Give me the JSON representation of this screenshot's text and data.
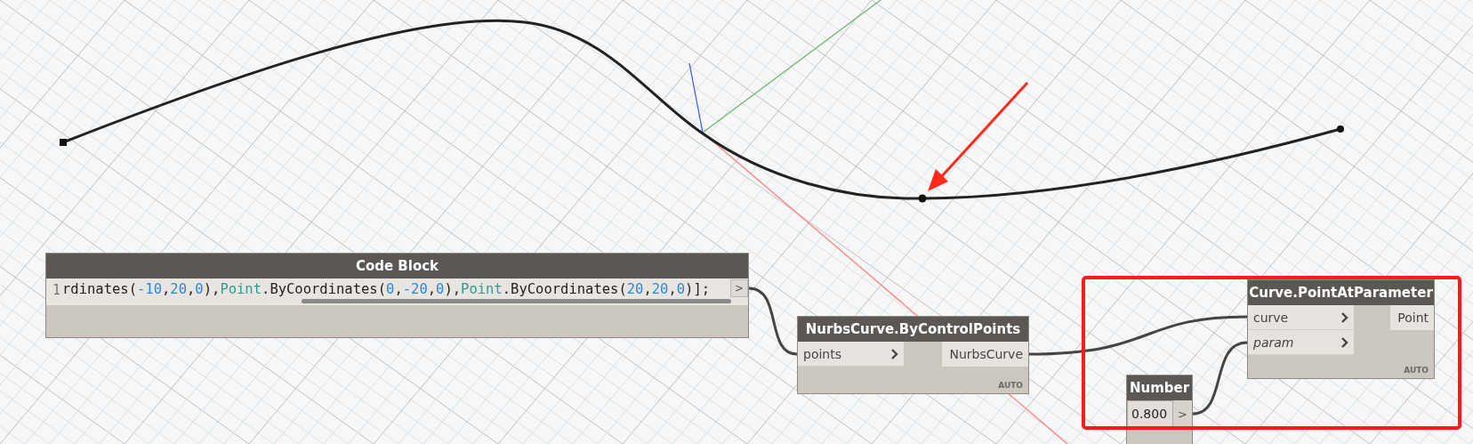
{
  "code_block": {
    "title": "Code Block",
    "line_number": "1",
    "tokens": [
      {
        "text": "rdinates(",
        "kind": "plain"
      },
      {
        "text": "-10",
        "kind": "number"
      },
      {
        "text": ",",
        "kind": "plain"
      },
      {
        "text": "20",
        "kind": "number"
      },
      {
        "text": ",",
        "kind": "plain"
      },
      {
        "text": "0",
        "kind": "number"
      },
      {
        "text": "),",
        "kind": "plain"
      },
      {
        "text": "Point",
        "kind": "type"
      },
      {
        "text": ".ByCoordinates(",
        "kind": "plain"
      },
      {
        "text": "0",
        "kind": "number"
      },
      {
        "text": ",",
        "kind": "plain"
      },
      {
        "text": "-20",
        "kind": "number"
      },
      {
        "text": ",",
        "kind": "plain"
      },
      {
        "text": "0",
        "kind": "number"
      },
      {
        "text": "),",
        "kind": "plain"
      },
      {
        "text": "Point",
        "kind": "type"
      },
      {
        "text": ".ByCoordinates(",
        "kind": "plain"
      },
      {
        "text": "20",
        "kind": "number"
      },
      {
        "text": ",",
        "kind": "plain"
      },
      {
        "text": "20",
        "kind": "number"
      },
      {
        "text": ",",
        "kind": "plain"
      },
      {
        "text": "0",
        "kind": "number"
      },
      {
        "text": ")];",
        "kind": "plain"
      }
    ],
    "output_port": ">"
  },
  "nurbs_node": {
    "title": "NurbsCurve.ByControlPoints",
    "inputs": [
      {
        "label": "points",
        "has_default": false
      }
    ],
    "outputs": [
      "NurbsCurve"
    ],
    "lacing": "AUTO"
  },
  "curve_node": {
    "title": "Curve.PointAtParameter",
    "inputs": [
      {
        "label": "curve",
        "has_default": false
      },
      {
        "label": "param",
        "has_default": true
      }
    ],
    "outputs": [
      "Point"
    ],
    "lacing": "AUTO"
  },
  "number_node": {
    "title": "Number",
    "value": "0.800",
    "output_port": ">"
  }
}
